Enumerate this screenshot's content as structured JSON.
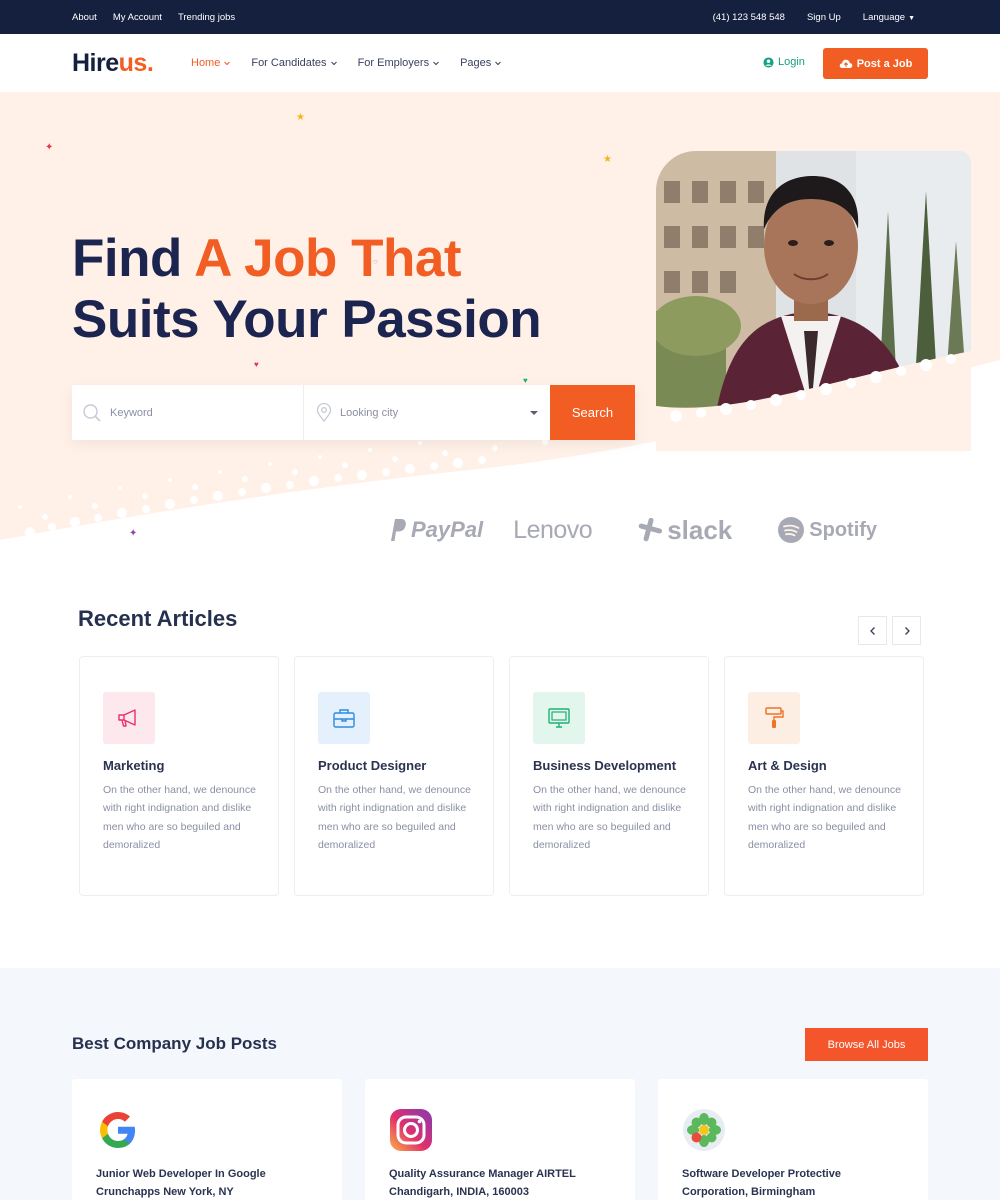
{
  "topbar": {
    "links": [
      "About",
      "My Account",
      "Trending jobs"
    ],
    "phone": "(41) 123 548 548",
    "signup": "Sign Up",
    "language": "Language"
  },
  "nav": {
    "logo_main": "Hire",
    "logo_accent": "us.",
    "menu": [
      {
        "label": "Home",
        "active": true
      },
      {
        "label": "For Candidates",
        "active": false
      },
      {
        "label": "For Employers",
        "active": false
      },
      {
        "label": "Pages",
        "active": false
      }
    ],
    "login": "Login",
    "post_job": "Post a Job"
  },
  "hero": {
    "title_line1_a": "Find ",
    "title_line1_b": "A Job That",
    "title_line2": "Suits Your Passion",
    "keyword_placeholder": "Keyword",
    "city_placeholder": "Looking city",
    "search_button": "Search",
    "brands": [
      "PayPal",
      "Lenovo",
      "slack",
      "Spotify"
    ]
  },
  "articles": {
    "title": "Recent Articles",
    "items": [
      {
        "title": "Marketing",
        "desc": "On the other hand, we denounce with right indignation and dislike men who are so beguiled and demoralized",
        "icon": "megaphone-icon",
        "bg": "#fde8ee",
        "color": "#e8336b"
      },
      {
        "title": "Product Designer",
        "desc": "On the other hand, we denounce with right indignation and dislike men who are so beguiled and demoralized",
        "icon": "briefcase-icon",
        "bg": "#e4f1fd",
        "color": "#2d8ae0"
      },
      {
        "title": "Business Development",
        "desc": "On the other hand, we denounce with right indignation and dislike men who are so beguiled and demoralized",
        "icon": "monitor-icon",
        "bg": "#e3f6ee",
        "color": "#1db173"
      },
      {
        "title": "Art & Design",
        "desc": "On the other hand, we denounce with right indignation and dislike men who are so beguiled and demoralized",
        "icon": "paint-roller-icon",
        "bg": "#fdeee4",
        "color": "#f0732a"
      }
    ]
  },
  "jobs": {
    "title": "Best Company Job Posts",
    "browse": "Browse All Jobs",
    "items": [
      {
        "line1": "Junior Web Developer In Google",
        "line2": "Crunchapps New York, NY",
        "logo": "google-logo-icon"
      },
      {
        "line1": "Quality Assurance Manager AIRTEL",
        "line2": "Chandigarh, INDIA, 160003",
        "logo": "instagram-logo-icon"
      },
      {
        "line1": "Software Developer Protective",
        "line2": "Corporation, Birmingham",
        "logo": "icq-flower-logo-icon"
      }
    ]
  },
  "colors": {
    "accent": "#f15d22",
    "navy": "#15203f",
    "hero_bg": "#fff1e8",
    "login_green": "#16a085"
  }
}
